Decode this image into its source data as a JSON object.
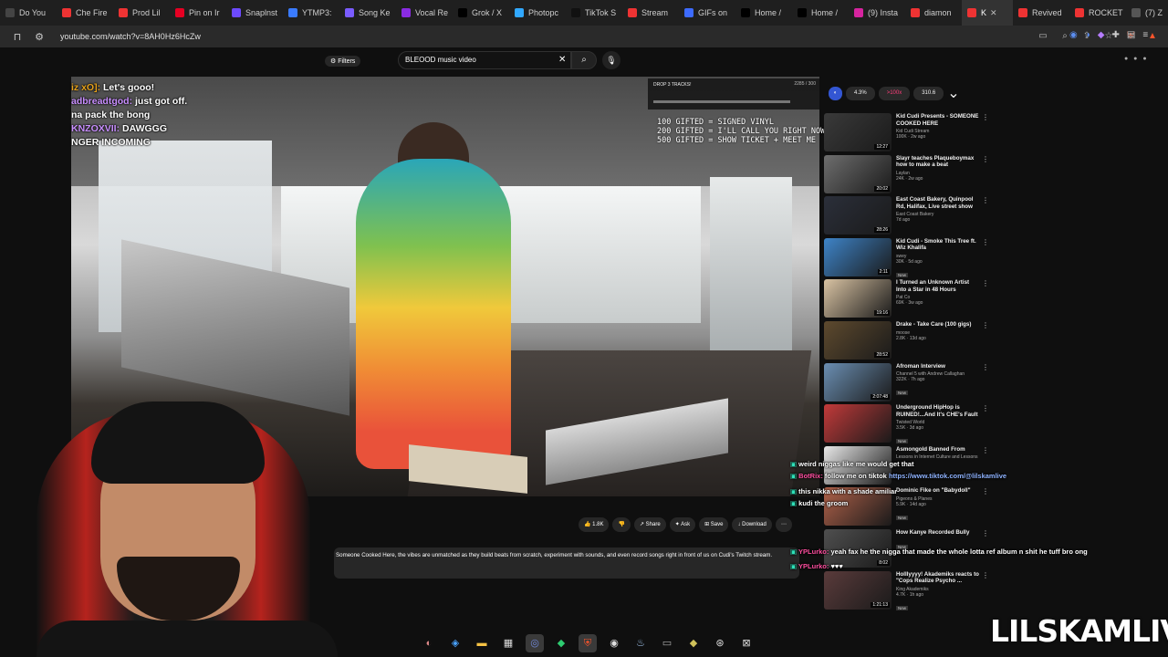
{
  "browser": {
    "tabs": [
      {
        "label": "Do You",
        "color": "#444"
      },
      {
        "label": "Che Fire",
        "color": "#e33"
      },
      {
        "label": "Prod Lil",
        "color": "#e33"
      },
      {
        "label": "Pin on Ir",
        "color": "#e60023"
      },
      {
        "label": "Snaplnst",
        "color": "#6d4aff"
      },
      {
        "label": "YTMP3:",
        "color": "#3a7bff"
      },
      {
        "label": "Song Ke",
        "color": "#7a5cff"
      },
      {
        "label": "Vocal Re",
        "color": "#8a2be2"
      },
      {
        "label": "Grok / X",
        "color": "#000"
      },
      {
        "label": "Photopc",
        "color": "#31a8ff"
      },
      {
        "label": "TikTok S",
        "color": "#111"
      },
      {
        "label": "Stream",
        "color": "#e33"
      },
      {
        "label": "GIFs on",
        "color": "#3d6bff"
      },
      {
        "label": "Home /",
        "color": "#000"
      },
      {
        "label": "Home /",
        "color": "#000"
      },
      {
        "label": "(9) Insta",
        "color": "#d6249f"
      },
      {
        "label": "diamon",
        "color": "#e33"
      },
      {
        "label": "K",
        "color": "#e33",
        "active": true
      },
      {
        "label": "Revived",
        "color": "#e33"
      },
      {
        "label": "ROCKET",
        "color": "#e33"
      },
      {
        "label": "(7) Z",
        "color": "#555"
      }
    ],
    "url": "youtube.com/watch?v=8AH0Hz6HcZw"
  },
  "youtube": {
    "filters_label": "Filters",
    "search_value": "BLEOOD music video",
    "actions": {
      "like": "1.8K",
      "share": "Share",
      "ask": "Ask",
      "save": "Save",
      "download": "Download"
    },
    "description": "Someone Cooked Here, the vibes are unmatched as they build beats from scratch, experiment with sounds, and even record songs right in front of us on Cudi's Twitch stream.",
    "chips": [
      "4.3%",
      ">100x",
      "310.6"
    ]
  },
  "overlay": {
    "chat": [
      {
        "user": "iz xO]:",
        "text": " Let's gooo!"
      },
      {
        "user": "adbreadtgod:",
        "text": " just got off."
      },
      {
        "user": "",
        "text": "na pack the bong"
      },
      {
        "user": "KNZOXVII:",
        "text": " DAWGGG"
      },
      {
        "user": "",
        "text": "NGER INCOMING"
      }
    ],
    "drop_title": "DROP 3 TRACKS!",
    "drop_stat": "2285 / 300",
    "gifts": [
      "100 GIFTED = SIGNED VINYL",
      "200 GIFTED = I'LL CALL YOU RIGHT NOW",
      "500 GIFTED = SHOW TICKET + MEET ME"
    ],
    "chat_right": [
      {
        "user": "",
        "text": "weird niggas like me would get that"
      },
      {
        "user": "BotRix:",
        "text": " follow me on tiktok ",
        "link": "https://www.tiktok.com/@lilskamlive"
      },
      {
        "user": "",
        "text": "this nikka with a shade amiliar"
      },
      {
        "user": "",
        "text": "kudi the groom"
      },
      {
        "user": "YPLurko:",
        "text": " yeah fax he the nigga that made the whole lotta ref album n shit he tuff bro ong"
      },
      {
        "user": "YPLurko:",
        "text": " ♥♥♥"
      }
    ],
    "watermark": "LILSKAMLIVE"
  },
  "recommendations": [
    {
      "title": "Kid Cudi Presents - SOMEONE COOKED HERE",
      "channel": "Kid Cudi Stream",
      "meta": "100K · 2w ago",
      "duration": "12:27",
      "color": "#3a3a3a"
    },
    {
      "title": "Slayr teaches Plaqueboymax how to make a beat",
      "channel": "Laylan",
      "meta": "24K · 2w ago",
      "duration": "20:02",
      "color": "#6e6e6e"
    },
    {
      "title": "East Coast Bakery, Quinpool Rd, Halifax, Live street show",
      "channel": "East Coast Bakery",
      "meta": "7d ago",
      "duration": "28:26",
      "color": "#2b2f3a"
    },
    {
      "title": "Kid Cudi - Smoke This Tree ft. Wiz Khalifa",
      "channel": "swey",
      "meta": "30K · 5d ago",
      "duration": "2:11",
      "badge": "New",
      "color": "#3e84c8"
    },
    {
      "title": "I Turned an Unknown Artist Into a Star in 48 Hours",
      "channel": "Pat Co",
      "meta": "69K · 3w ago",
      "duration": "19:16",
      "color": "#d9c3a3"
    },
    {
      "title": "Drake - Take Care (100 gigs)",
      "channel": "moose",
      "meta": "2.8K · 13d ago",
      "duration": "28:52",
      "color": "#5e4a2e"
    },
    {
      "title": "Afroman Interview",
      "channel": "Channel 5 with Andrew Callaghan",
      "meta": "322K · 7h ago",
      "duration": "2:07:48",
      "badge": "New",
      "color": "#6b8fb3"
    },
    {
      "title": "Underground HipHop is RUINED!...And It's CHE's Fault",
      "channel": "Twisted World",
      "meta": "3.5K · 3d ago",
      "duration": "",
      "badge": "New",
      "color": "#c23a3a"
    },
    {
      "title": "Asmongold Banned From",
      "channel": "Lessons in Internet Culture and Lessons",
      "meta": "",
      "duration": "",
      "color": "#e8e8e8"
    },
    {
      "title": "Dominic Fike on \"Babydoll\"",
      "channel": "Pigeons & Planes",
      "meta": "5.9K · 14d ago",
      "duration": "",
      "badge": "New",
      "color": "#b1624a"
    },
    {
      "title": "How Kanye Recorded Bully",
      "channel": "",
      "meta": "",
      "duration": "8:02",
      "badge": "New",
      "color": "#4f4f4f"
    },
    {
      "title": "Holllyyyy! Akademiks reacts to \"Cops Realize Psycho ...",
      "channel": "King Akademiks",
      "meta": "4.7K · 1h ago",
      "duration": "1:21:13",
      "badge": "New",
      "color": "#5a3b3b"
    }
  ]
}
